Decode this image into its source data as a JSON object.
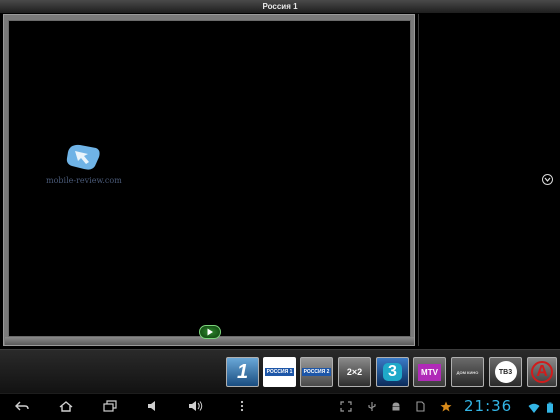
{
  "window": {
    "title": "Россия 1"
  },
  "player": {
    "watermark_text": "mobile-review.com",
    "play_button_icon": "play-icon"
  },
  "side_panel": {
    "expand_icon": "chevron-down-icon"
  },
  "channels": [
    {
      "id": "perviy",
      "label": "1",
      "selected": false
    },
    {
      "id": "rossiya1",
      "label": "РОССИЯ 1",
      "selected": true
    },
    {
      "id": "rossiya2",
      "label": "РОССИЯ 2",
      "selected": false
    },
    {
      "id": "2x2",
      "label": "2×2",
      "selected": false
    },
    {
      "id": "ch3",
      "label": "3",
      "selected": false
    },
    {
      "id": "mtv",
      "label": "MTV",
      "selected": false
    },
    {
      "id": "domkino",
      "label": "ДОМ КИНО",
      "selected": false
    },
    {
      "id": "tv3",
      "label": "ТВ3",
      "selected": false
    },
    {
      "id": "a-channel",
      "label": "А",
      "selected": false
    }
  ],
  "statusbar": {
    "time": "21:36"
  },
  "colors": {
    "clock": "#33b5e5",
    "play_button": "#2e8a2e",
    "selected_channel": "#ffffff"
  }
}
